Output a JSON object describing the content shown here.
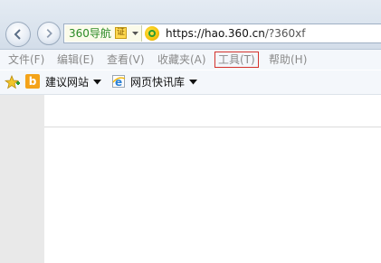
{
  "address_bar": {
    "site_name": "360导航",
    "cert_badge": "证",
    "url_main": "https://hao.360.cn",
    "url_rest": "/?360xf"
  },
  "menu": {
    "items": [
      {
        "label": "文件(F)"
      },
      {
        "label": "编辑(E)"
      },
      {
        "label": "查看(V)"
      },
      {
        "label": "收藏夹(A)"
      },
      {
        "label": "工具(T)"
      },
      {
        "label": "帮助(H)"
      }
    ]
  },
  "favorites": {
    "items": [
      {
        "label": "建议网站",
        "icon": "bing-icon"
      },
      {
        "label": "网页快讯库",
        "icon": "ie-icon"
      }
    ],
    "bing_letter": "b"
  },
  "colors": {
    "highlight_border": "#d4322c",
    "menu_text": "#8a8a8a",
    "site_name": "#2a8a25"
  }
}
